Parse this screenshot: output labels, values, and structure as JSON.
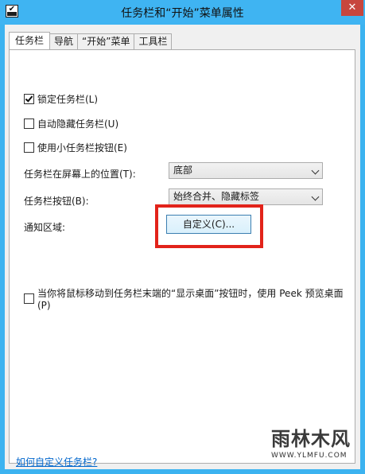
{
  "window": {
    "title": "任务栏和“开始”菜单属性",
    "close_label": "✕"
  },
  "tabs": [
    {
      "label": "任务栏",
      "active": true
    },
    {
      "label": "导航",
      "active": false
    },
    {
      "label": "“开始”菜单",
      "active": false
    },
    {
      "label": "工具栏",
      "active": false
    }
  ],
  "taskbar": {
    "lock": {
      "label": "锁定任务栏(L)",
      "checked": true
    },
    "autohide": {
      "label": "自动隐藏任务栏(U)",
      "checked": false
    },
    "small_buttons": {
      "label": "使用小任务栏按钮(E)",
      "checked": false
    },
    "location": {
      "label": "任务栏在屏幕上的位置(T):",
      "value": "底部"
    },
    "buttons": {
      "label": "任务栏按钮(B):",
      "value": "始终合并、隐藏标签"
    },
    "notify": {
      "label": "通知区域:",
      "button_label": "自定义(C)..."
    },
    "peek": {
      "label": "当你将鼠标移动到任务栏末端的“显示桌面”按钮时，使用 Peek 预览桌面(P)",
      "checked": false
    },
    "help_link": "如何自定义任务栏?"
  },
  "watermark": {
    "logo": "雨林木风",
    "url": "WWW.YLMFU.COM"
  },
  "colors": {
    "titlebar": "#3fb4f2",
    "close": "#c7463e",
    "highlight": "#e2231a",
    "link": "#0066cc"
  }
}
